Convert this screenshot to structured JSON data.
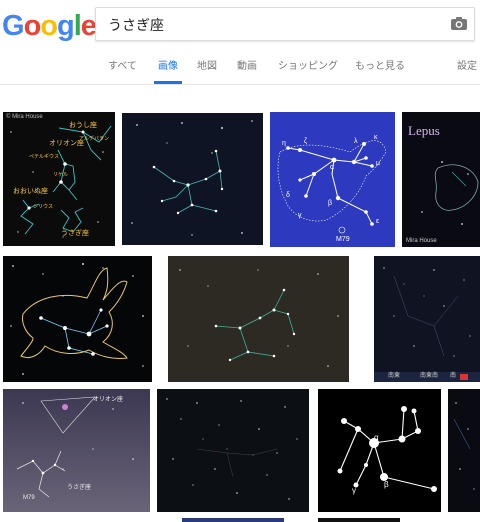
{
  "logo": [
    "G",
    "o",
    "o",
    "g",
    "l",
    "e"
  ],
  "logo_colors": [
    "#4285f4",
    "#ea4335",
    "#fbbc05",
    "#4285f4",
    "#34a853",
    "#ea4335"
  ],
  "search": {
    "query": "うさぎ座"
  },
  "tabs": [
    "すべて",
    "画像",
    "地図",
    "動画",
    "ショッピング",
    "もっと見る",
    "設定"
  ],
  "active_tab": "画像",
  "accent": "#1a73e8",
  "images": {
    "img1": {
      "labels": [
        "おうし座",
        "オリオン座",
        "アルデバラン",
        "ペテルギウス",
        "リゲル",
        "おおいぬ座",
        "シリウス",
        "うさぎ座"
      ]
    },
    "img3": {
      "labels": [
        "η",
        "ζ",
        "α",
        "λ",
        "κ",
        "μ",
        "β",
        "δ",
        "γ",
        "ε",
        "M79"
      ]
    },
    "img4": {
      "title": "Lepus",
      "credit": "Mira House"
    },
    "img6": {
      "labels": [
        "南東",
        "南東南",
        "南"
      ]
    },
    "img7": {
      "labels": [
        "オリオン座",
        "M79",
        "うさぎ座"
      ]
    },
    "img8": {
      "labels": [
        "α",
        "β",
        "γ"
      ]
    }
  }
}
